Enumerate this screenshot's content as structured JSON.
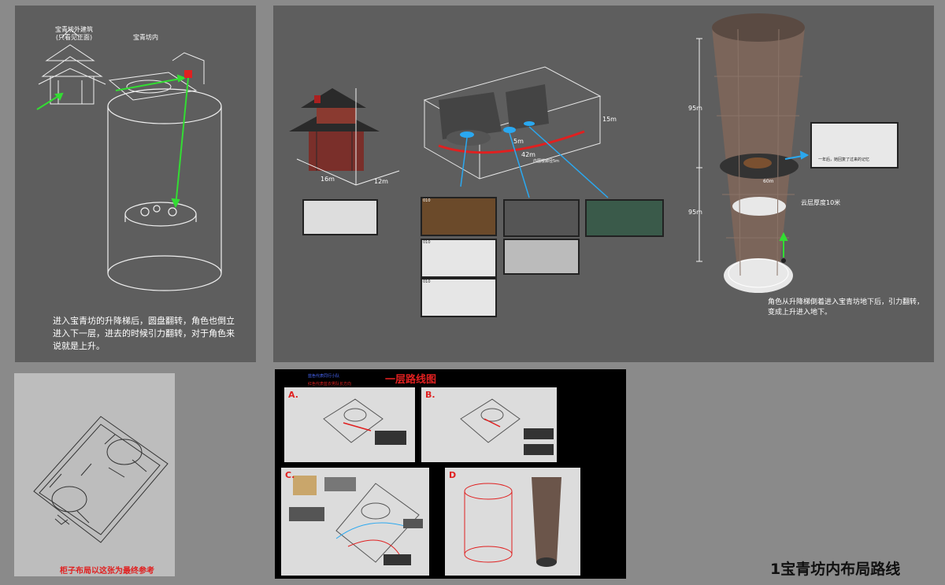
{
  "panel1": {
    "label_exterior": "宝青坊外建筑",
    "label_exterior_note": "(只看见正面)",
    "label_interior": "宝青坊内",
    "caption": "进入宝青坊的升降梯后，圆盘翻转，角色也倒立进入下一层，进去的时候引力翻转，对于角色来说就是上升。"
  },
  "panel2": {
    "dim_16m": "16m",
    "dim_12m": "12m",
    "dim_15m": "15m",
    "dim_5m": "5m",
    "dim_42m": "42m",
    "inner_note": "内围楼廊径5m",
    "shot_nums": [
      "010",
      "010",
      "010"
    ],
    "tower_height_upper": "95m",
    "tower_height_lower": "95m",
    "disc_width": "60m",
    "cloud_label": "云层厚度10米",
    "subtitle_in_shot": "一年后，她回复了过来的记忆",
    "caption": "角色从升降梯倒着进入宝青坊地下后，引力翻转，变成上升进入地下。"
  },
  "panel3": {
    "note": "柜子布局以这张为最终参考",
    "note_color": "#e02020"
  },
  "panel4": {
    "title": "一层路线图",
    "legend_blue": "蓝色代表同行小队",
    "legend_red": "红色代表蓝衣男队长方向",
    "letters": [
      "A.",
      "B.",
      "C.",
      "D"
    ]
  },
  "footer": {
    "title": "1宝青坊内布局路线"
  },
  "colors": {
    "arrow_green": "#33dd33",
    "arrow_blue": "#2aa8f0",
    "route_red": "#e02020"
  }
}
